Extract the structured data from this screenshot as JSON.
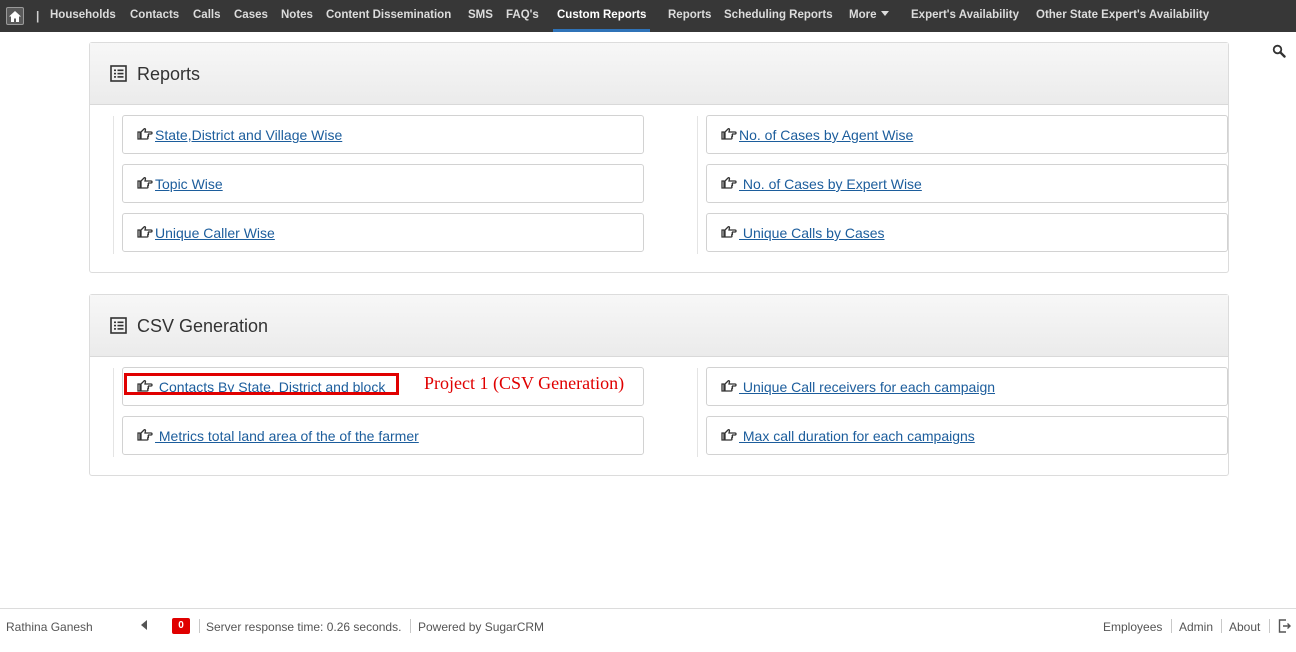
{
  "nav": {
    "separator": "|",
    "items": [
      "Households",
      "Contacts",
      "Calls",
      "Cases",
      "Notes",
      "Content Dissemination",
      "SMS",
      "FAQ's",
      "Custom Reports",
      "Reports",
      "Scheduling Reports",
      "More",
      "Expert's Availability",
      "Other State Expert's Availability"
    ],
    "active": "Custom Reports"
  },
  "reports_panel": {
    "title": "Reports",
    "left_links": [
      "State,District and Village Wise",
      "Topic Wise",
      "Unique Caller Wise"
    ],
    "right_links": [
      "No. of Cases by Agent Wise",
      " No. of Cases by Expert Wise",
      " Unique Calls by Cases"
    ]
  },
  "csv_panel": {
    "title": "CSV Generation",
    "left_links": [
      " Contacts By State, District and block",
      " Metrics total land area of the of the farmer"
    ],
    "right_links": [
      " Unique Call receivers for each campaign",
      " Max call duration for each campaigns"
    ]
  },
  "annotation": {
    "text": "Project 1 (CSV Generation)",
    "color": "#e00000"
  },
  "footer": {
    "user": "Rathina Ganesh",
    "notification_count": "0",
    "server_response": "Server response time: 0.26 seconds.",
    "powered_by": "Powered by SugarCRM",
    "links": [
      "Employees",
      "Admin",
      "About"
    ]
  },
  "icons": {
    "home": "home-icon",
    "search": "search-icon",
    "panel": "list-icon",
    "link": "hand-pointer-icon",
    "logout": "logout-icon",
    "collapse": "caret-left-icon"
  },
  "colors": {
    "nav_background": "#373737",
    "active_underline": "#2f73b8",
    "link": "#1c5d9c",
    "highlight": "#e00000"
  }
}
